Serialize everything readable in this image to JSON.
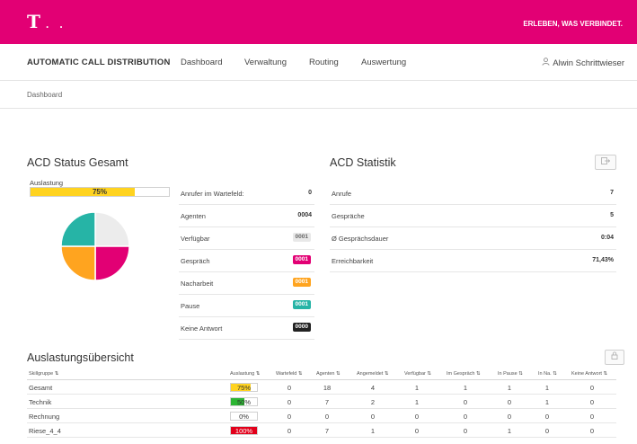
{
  "header": {
    "logo_text": "T",
    "logo_dots": "· ·",
    "slogan": "ERLEBEN, WAS VERBINDET."
  },
  "nav": {
    "brand": "AUTOMATIC CALL DISTRIBUTION",
    "items": [
      {
        "label": "Dashboard"
      },
      {
        "label": "Verwaltung"
      },
      {
        "label": "Routing"
      },
      {
        "label": "Auswertung"
      }
    ],
    "user_name": "Alwin Schrittwieser",
    "user_icon": "user-icon"
  },
  "breadcrumb": {
    "current": "Dashboard"
  },
  "acd_status": {
    "title": "ACD Status Gesamt",
    "utilization_label": "Auslastung",
    "utilization_text": "75%",
    "utilization_value": 0.75,
    "utilization_color": "#ffd320",
    "pie_colors": [
      "#ececec",
      "#e20074",
      "#ffa41f",
      "#26b4a6"
    ],
    "pie_values": [
      25,
      25,
      25,
      25
    ],
    "rows": [
      {
        "label": "Anrufer im Wartefeld:",
        "value": "0"
      },
      {
        "label": "Agenten",
        "value": "0004"
      },
      {
        "label": "Verfügbar",
        "value": "0001",
        "color": "#e8e8e8",
        "text_color": "#666"
      },
      {
        "label": "Gespräch",
        "value": "0001",
        "color": "#e20074",
        "text_color": "#ffffff"
      },
      {
        "label": "Nacharbeit",
        "value": "0001",
        "color": "#ffa41f",
        "text_color": "#ffffff"
      },
      {
        "label": "Pause",
        "value": "0001",
        "color": "#26b4a6",
        "text_color": "#ffffff"
      },
      {
        "label": "Keine Antwort",
        "value": "0000",
        "color": "#222222",
        "text_color": "#ffffff"
      }
    ]
  },
  "acd_statistik": {
    "title": "ACD Statistik",
    "export_icon": "export-icon",
    "rows": [
      {
        "label": "Anrufe",
        "value": "7"
      },
      {
        "label": "Gespräche",
        "value": "5"
      },
      {
        "label": "Ø Gesprächsdauer",
        "value": "0:04"
      },
      {
        "label": "Erreichbarkeit",
        "value": "71,43%"
      }
    ]
  },
  "auslastung": {
    "title": "Auslastungsübersicht",
    "lock_icon": "lock-icon",
    "headers": [
      "Skillgruppe ⇅",
      "Auslastung ⇅",
      "Wartefeld ⇅",
      "Agenten ⇅",
      "Angemeldet ⇅",
      "Verfügbar ⇅",
      "Im Gespräch ⇅",
      "In Pause ⇅",
      "In Na. ⇅",
      "Keine Antwort ⇅"
    ],
    "rows": [
      {
        "name": "Gesamt",
        "util": "75%",
        "util_value": 0.75,
        "util_color": "#ffd320",
        "util_text_color": "#333",
        "cells": [
          "0",
          "18",
          "4",
          "1",
          "1",
          "1",
          "1",
          "0"
        ]
      },
      {
        "name": "Technik",
        "util": "50%",
        "util_value": 0.5,
        "util_color": "#2bb532",
        "util_text_color": "#333",
        "cells": [
          "0",
          "7",
          "2",
          "1",
          "0",
          "0",
          "1",
          "0"
        ]
      },
      {
        "name": "Rechnung",
        "util": "0%",
        "util_value": 0,
        "util_color": "#ffffff",
        "util_text_color": "#333",
        "cells": [
          "0",
          "0",
          "0",
          "0",
          "0",
          "0",
          "0",
          "0"
        ]
      },
      {
        "name": "Riese_4_4",
        "util": "100%",
        "util_value": 1,
        "util_color": "#e2001a",
        "util_text_color": "#ffffff",
        "cells": [
          "0",
          "7",
          "1",
          "0",
          "0",
          "1",
          "0",
          "0"
        ]
      }
    ]
  }
}
